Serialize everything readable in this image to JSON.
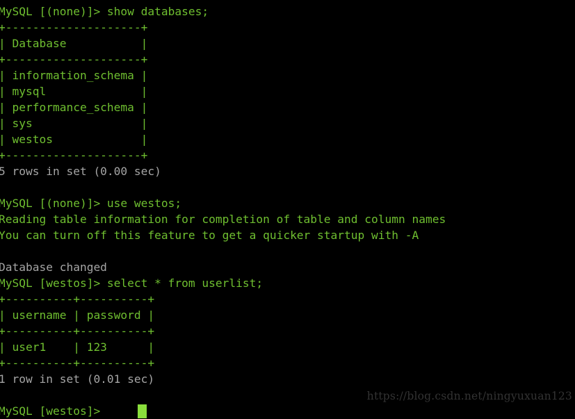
{
  "terminal": {
    "title": "MySQL client session",
    "colors": {
      "background": "#000000",
      "prompt_green": "#6fbf30",
      "status_gray": "#a5a5a5",
      "cursor_green": "#8ade3c",
      "watermark_gray": "#333333"
    },
    "lines": [
      {
        "text": "MySQL [(none)]> show databases;",
        "style": "green"
      },
      {
        "text": "+--------------------+",
        "style": "green"
      },
      {
        "text": "| Database           |",
        "style": "green"
      },
      {
        "text": "+--------------------+",
        "style": "green"
      },
      {
        "text": "| information_schema |",
        "style": "green"
      },
      {
        "text": "| mysql              |",
        "style": "green"
      },
      {
        "text": "| performance_schema |",
        "style": "green"
      },
      {
        "text": "| sys                |",
        "style": "green"
      },
      {
        "text": "| westos             |",
        "style": "green"
      },
      {
        "text": "+--------------------+",
        "style": "green"
      },
      {
        "text": "5 rows in set (0.00 sec)",
        "style": "gray"
      },
      {
        "text": " ",
        "style": "blank"
      },
      {
        "text": "MySQL [(none)]> use westos;",
        "style": "green"
      },
      {
        "text": "Reading table information for completion of table and column names",
        "style": "green"
      },
      {
        "text": "You can turn off this feature to get a quicker startup with -A",
        "style": "green"
      },
      {
        "text": " ",
        "style": "blank"
      },
      {
        "text": "Database changed",
        "style": "gray"
      },
      {
        "text": "MySQL [westos]> select * from userlist;",
        "style": "green"
      },
      {
        "text": "+----------+----------+",
        "style": "green"
      },
      {
        "text": "| username | password |",
        "style": "green"
      },
      {
        "text": "+----------+----------+",
        "style": "green"
      },
      {
        "text": "| user1    | 123      |",
        "style": "green"
      },
      {
        "text": "+----------+----------+",
        "style": "green"
      },
      {
        "text": "1 row in set (0.01 sec)",
        "style": "gray"
      },
      {
        "text": " ",
        "style": "blank"
      },
      {
        "text": "MySQL [westos]> ",
        "style": "green",
        "cursor": true
      }
    ],
    "commands": [
      "show databases;",
      "use westos;",
      "select * from userlist;"
    ],
    "databases_table": {
      "header": "Database",
      "rows": [
        "information_schema",
        "mysql",
        "performance_schema",
        "sys",
        "westos"
      ],
      "result_status": "5 rows in set (0.00 sec)"
    },
    "userlist_table": {
      "headers": [
        "username",
        "password"
      ],
      "rows": [
        [
          "user1",
          "123"
        ]
      ],
      "result_status": "1 row in set (0.01 sec)"
    },
    "messages": {
      "reading_table": "Reading table information for completion of table and column names",
      "turn_off_hint": "You can turn off this feature to get a quicker startup with -A",
      "database_changed": "Database changed"
    },
    "prompts": {
      "none_db": "MySQL [(none)]> ",
      "westos_db": "MySQL [westos]> "
    }
  },
  "watermark": {
    "text": "https://blog.csdn.net/ningyuxuan123"
  }
}
